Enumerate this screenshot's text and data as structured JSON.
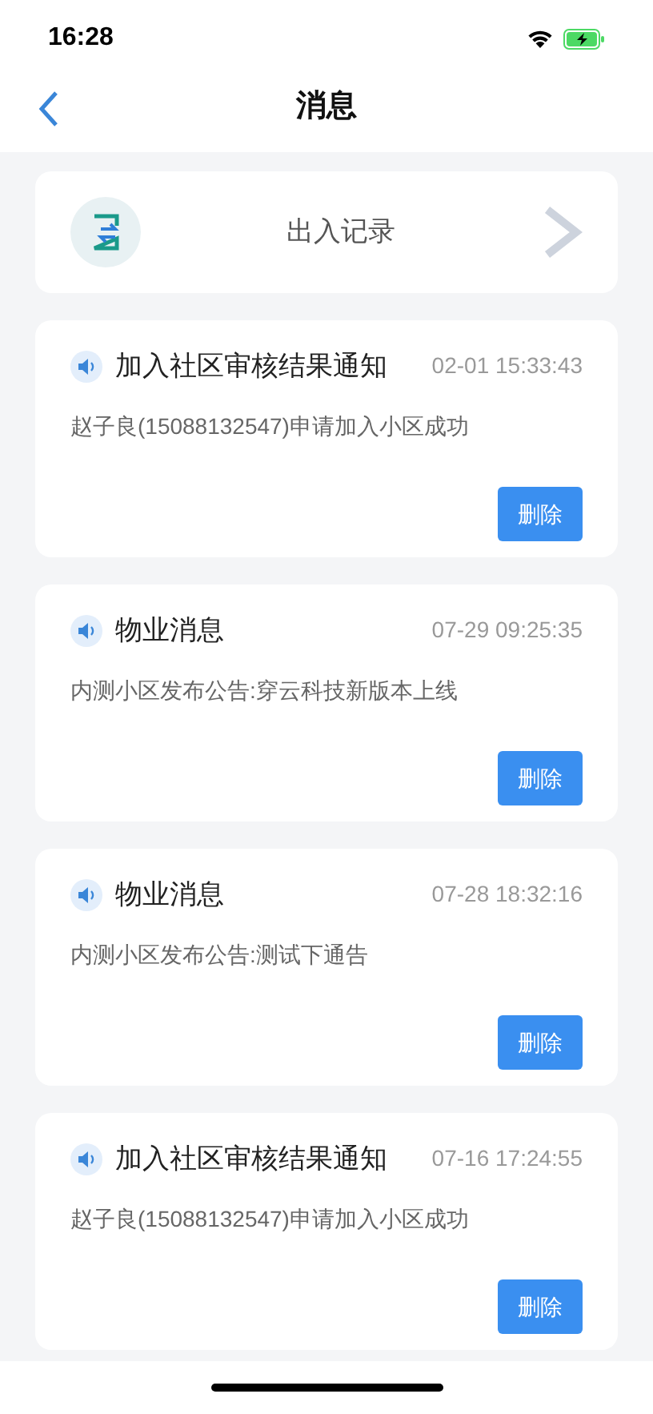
{
  "status_bar": {
    "time": "16:28"
  },
  "nav": {
    "title": "消息"
  },
  "entry_card": {
    "label": "出入记录"
  },
  "messages": [
    {
      "title": "加入社区审核结果通知",
      "time": "02-01 15:33:43",
      "body": "赵子良(15088132547)申请加入小区成功",
      "action": "删除"
    },
    {
      "title": "物业消息",
      "time": "07-29 09:25:35",
      "body": "内测小区发布公告:穿云科技新版本上线",
      "action": "删除"
    },
    {
      "title": "物业消息",
      "time": "07-28 18:32:16",
      "body": "内测小区发布公告:测试下通告",
      "action": "删除"
    },
    {
      "title": "加入社区审核结果通知",
      "time": "07-16 17:24:55",
      "body": "赵子良(15088132547)申请加入小区成功",
      "action": "删除"
    }
  ]
}
